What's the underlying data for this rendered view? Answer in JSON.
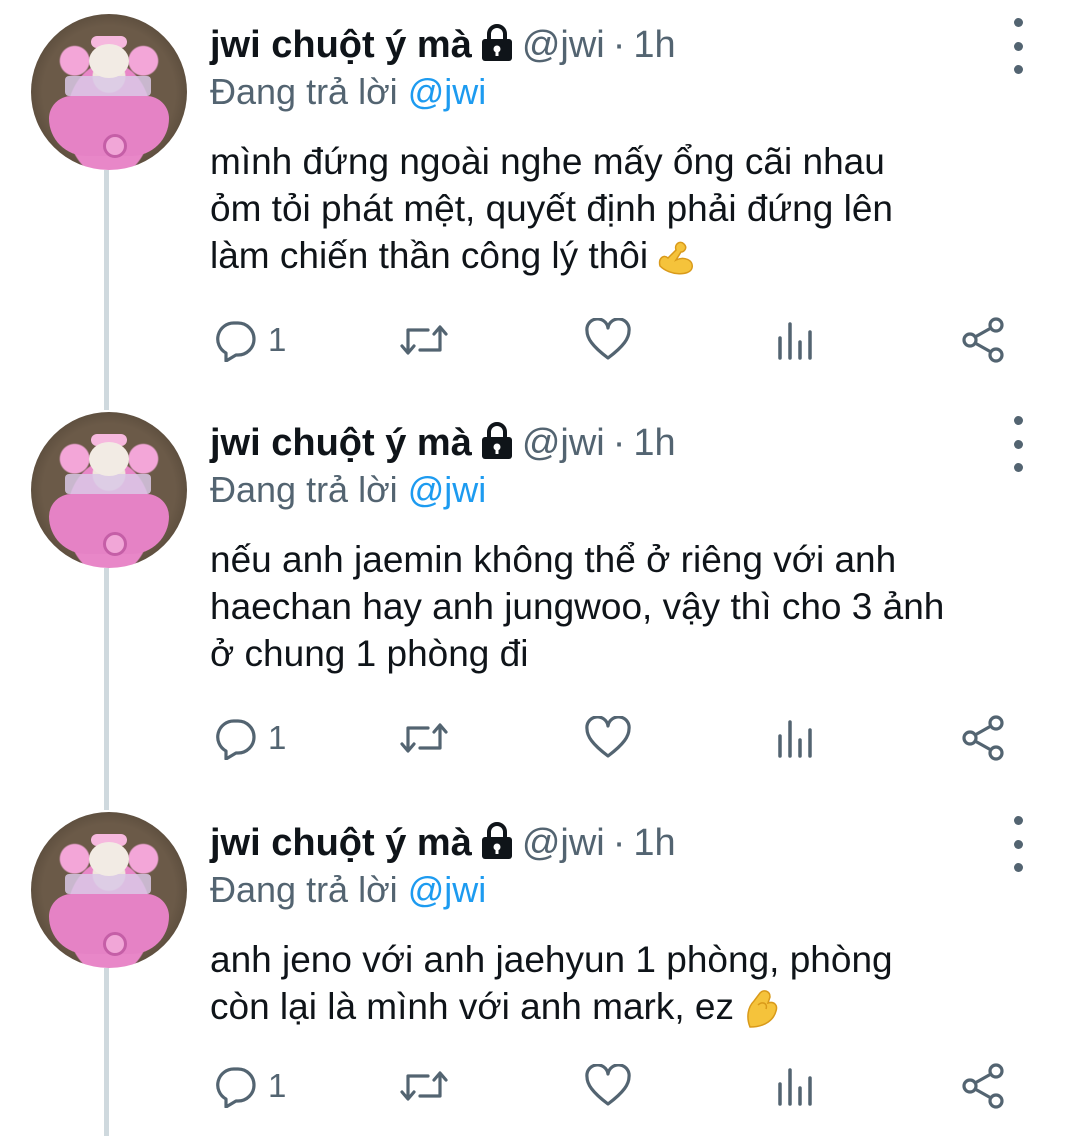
{
  "tweets": [
    {
      "name": "jwi chuột ý mà",
      "handle": "@jwi",
      "separator": "·",
      "time": "1h",
      "replying_prefix": "Đang trả lời",
      "replying_to": "@jwi",
      "text_lines": [
        "mình đứng ngoài nghe mấy ổng cãi nhau",
        "ỏm tỏi phát mệt, quyết định phải đứng lên",
        "làm chiến thần công lý thôi"
      ],
      "emoji": "flexed-biceps",
      "reply_count": "1"
    },
    {
      "name": "jwi chuột ý mà",
      "handle": "@jwi",
      "separator": "·",
      "time": "1h",
      "replying_prefix": "Đang trả lời",
      "replying_to": "@jwi",
      "text_lines": [
        "nếu anh jaemin không thể ở riêng với anh",
        "haechan hay anh jungwoo, vậy thì cho 3 ảnh",
        "ở chung 1 phòng đi"
      ],
      "emoji": "",
      "reply_count": "1"
    },
    {
      "name": "jwi chuột ý mà",
      "handle": "@jwi",
      "separator": "·",
      "time": "1h",
      "replying_prefix": "Đang trả lời",
      "replying_to": "@jwi",
      "text_lines": [
        "anh jeno với anh jaehyun 1 phòng, phòng",
        "còn lại là mình với anh mark, ez"
      ],
      "emoji": "pinched-fingers",
      "reply_count": "1"
    }
  ],
  "icons": {
    "lock": "lock-icon",
    "reply": "reply-icon",
    "retweet": "retweet-icon",
    "like": "like-icon",
    "analytics": "analytics-icon",
    "share": "share-icon",
    "more": "more-options-icon"
  },
  "colors": {
    "text": "#0f1419",
    "secondary": "#536471",
    "mention": "#1d9bf0",
    "thread_line": "#cfd9de"
  }
}
